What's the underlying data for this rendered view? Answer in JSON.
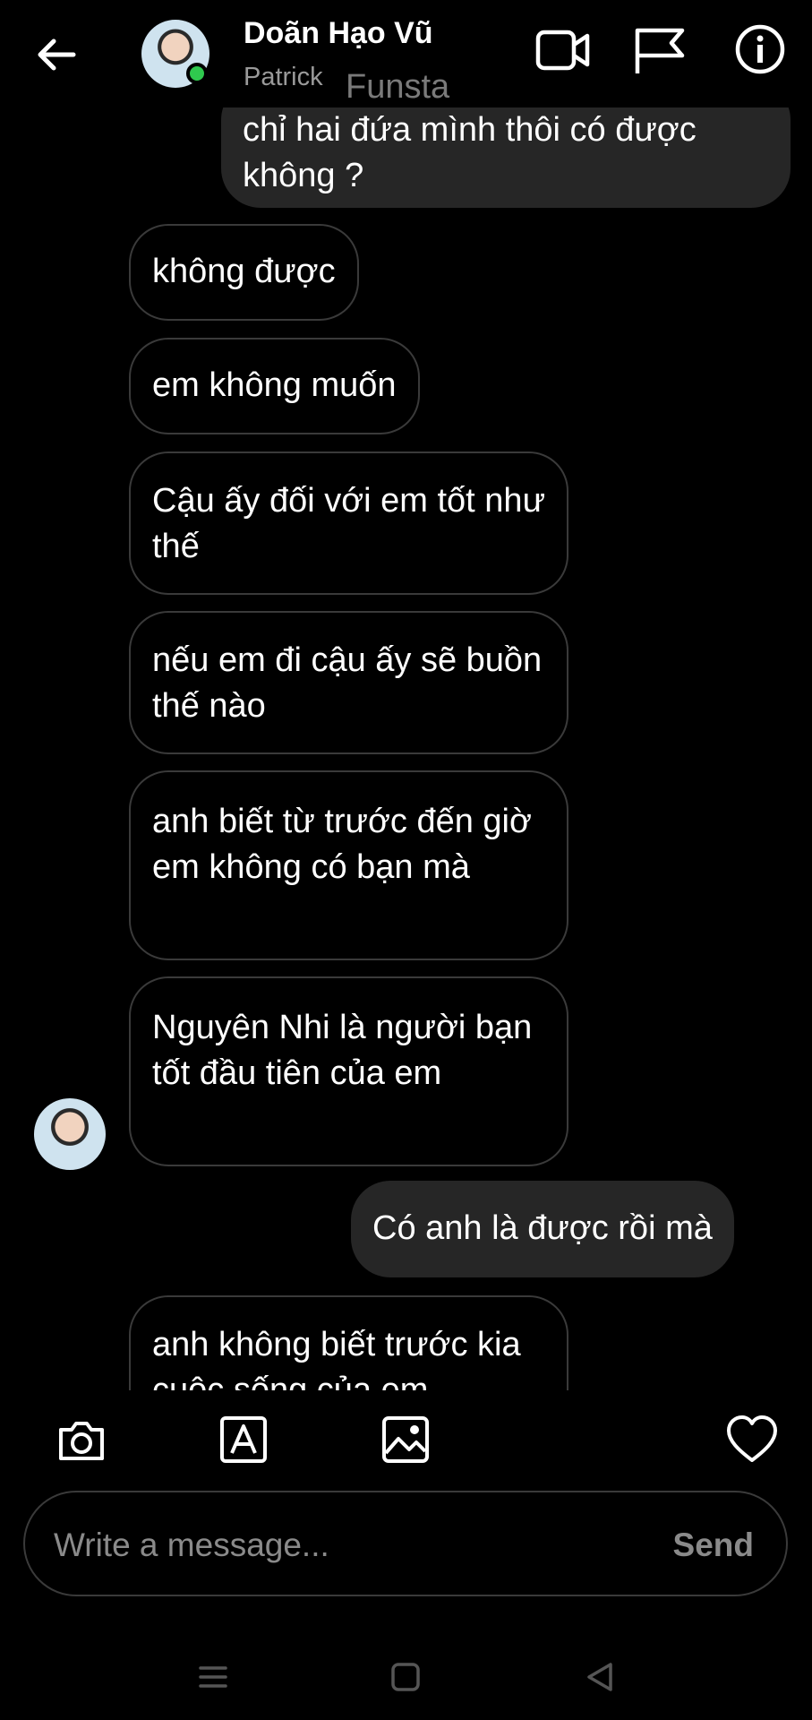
{
  "header": {
    "name": "Doãn Hạo Vũ",
    "username": "Patrick",
    "overlay_text": "Funsta"
  },
  "messages": [
    {
      "from": "me",
      "text": "chỉ hai đứa mình thôi có được không ?"
    },
    {
      "from": "them",
      "text": "không được"
    },
    {
      "from": "them",
      "text": "em không muốn"
    },
    {
      "from": "them",
      "text": "Cậu ấy đối với em tốt như thế"
    },
    {
      "from": "them",
      "text": "nếu em đi cậu ấy sẽ buồn thế nào"
    },
    {
      "from": "them",
      "text": "anh biết từ trước đến giờ em không có bạn mà"
    },
    {
      "from": "them",
      "text": "Nguyên Nhi là người bạn tốt đầu tiên của em"
    },
    {
      "from": "me",
      "text": "Có anh là được rồi mà"
    },
    {
      "from": "them",
      "text": "anh không biết trước kia cuộc sống của em"
    }
  ],
  "composer": {
    "placeholder": "Write a message...",
    "send_label": "Send"
  },
  "icons": {
    "back": "arrow-left-icon",
    "video": "video-camera-icon",
    "flag": "flag-icon",
    "info": "info-icon",
    "camera": "camera-icon",
    "sticker": "text-sticker-icon",
    "gallery": "image-icon",
    "like": "heart-icon",
    "nav_menu": "menu-icon",
    "nav_home": "square-icon",
    "nav_back": "triangle-back-icon"
  },
  "colors": {
    "background": "#000000",
    "sent_bubble": "#262626",
    "received_border": "#3a3a3a",
    "online": "#2fc94e"
  }
}
